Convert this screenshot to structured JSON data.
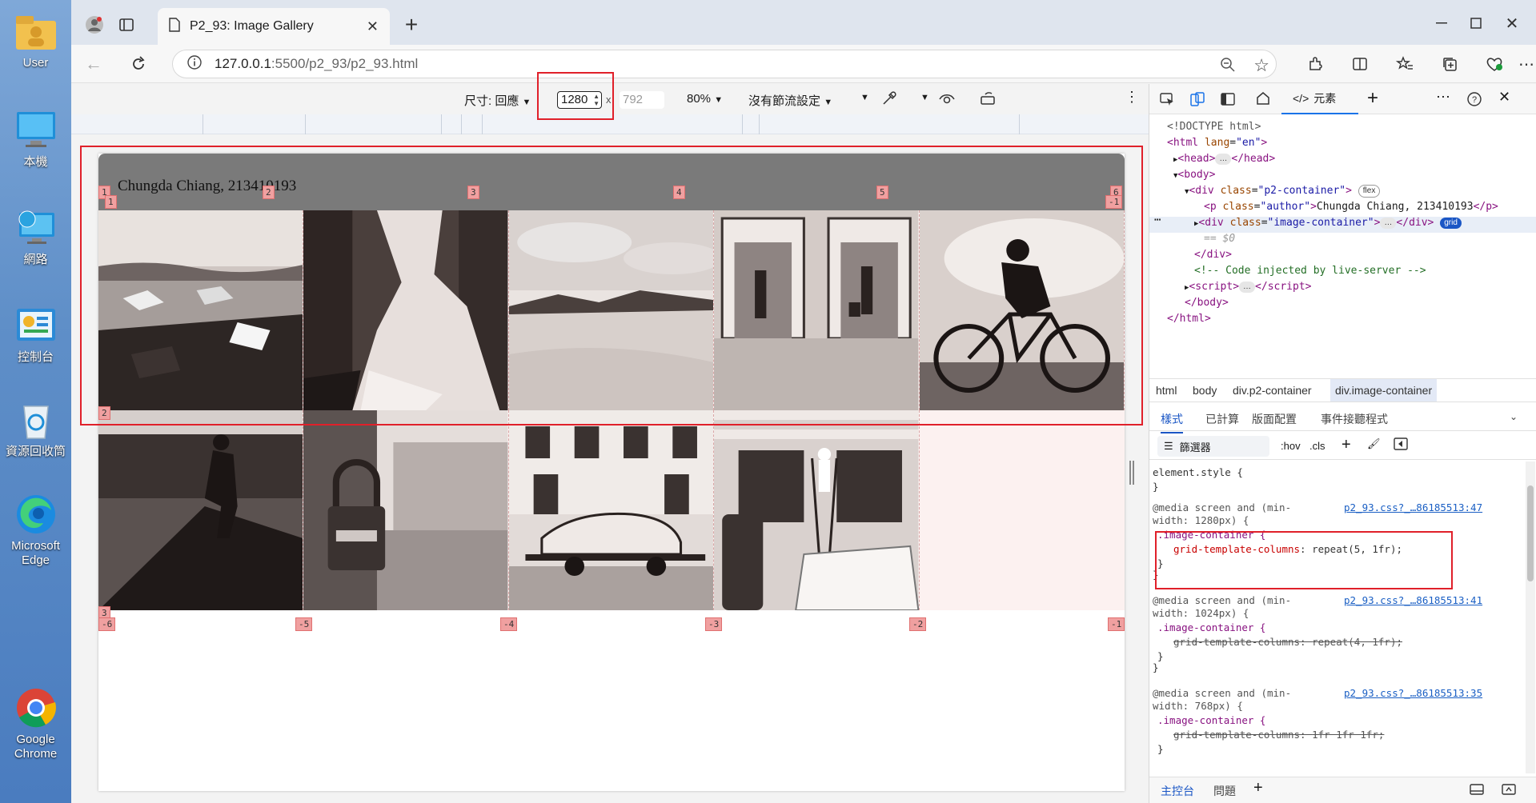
{
  "desktop": {
    "icons": [
      {
        "label": "User",
        "icon": "user-folder-icon"
      },
      {
        "label": "本機",
        "icon": "computer-icon"
      },
      {
        "label": "網路",
        "icon": "network-icon"
      },
      {
        "label": "控制台",
        "icon": "control-panel-icon"
      },
      {
        "label": "資源回收筒",
        "icon": "recycle-bin-icon"
      },
      {
        "label": "Microsoft Edge",
        "icon": "edge-icon"
      },
      {
        "label": "Google Chrome",
        "icon": "chrome-icon"
      }
    ]
  },
  "browser": {
    "tab_title": "P2_93: Image Gallery",
    "url_host": "127.0.0.1",
    "url_rest": ":5500/p2_93/p2_93.html"
  },
  "device_toolbar": {
    "dimensions_label": "尺寸: 回應",
    "width": "1280",
    "times": "x",
    "height": "792",
    "zoom": "80%",
    "throttle": "沒有節流設定"
  },
  "page": {
    "author": "Chungda Chiang, 213410193",
    "grid_badges": {
      "columns_top": [
        "1",
        "2",
        "3",
        "4",
        "5",
        "6"
      ],
      "columns_bottom": [
        "-6",
        "-5",
        "-4",
        "-3",
        "-2",
        "-1"
      ],
      "rows_left": [
        "1",
        "2",
        "3"
      ],
      "row_neg_top_right": "-1"
    },
    "images": [
      {
        "subject": "icebergs on shore"
      },
      {
        "subject": "forest waterfall"
      },
      {
        "subject": "desert dunes"
      },
      {
        "subject": "airport lifts"
      },
      {
        "subject": "cyclist silhouette"
      },
      {
        "subject": "walking man by building"
      },
      {
        "subject": "padlock on street"
      },
      {
        "subject": "car on trailer"
      },
      {
        "subject": "worker on ladder"
      }
    ]
  },
  "devtools": {
    "elements_tab": "元素",
    "dom": {
      "doctype": "<!DOCTYPE html>",
      "html_open_tag": "html",
      "html_lang_attr": "lang",
      "html_lang_val": "\"en\"",
      "head": "head",
      "body": "body",
      "div_class_val": "\"p2-container\"",
      "flex_pill": "flex",
      "p_class_val": "\"author\"",
      "p_text": "Chungda Chiang, 213410193",
      "imgc_class_val": "\"image-container\"",
      "grid_pill": "grid",
      "eq_s0": "== $0",
      "comment": "<!-- Code injected by live-server -->",
      "script": "script"
    },
    "breadcrumbs": [
      "html",
      "body",
      "div.p2-container",
      "div.image-container"
    ],
    "style_tabs": [
      "樣式",
      "已計算",
      "版面配置",
      "事件接聽程式"
    ],
    "filter_label": "篩選器",
    "hov": ":hov",
    "cls": ".cls",
    "styles": {
      "element_style": "element.style {",
      "close": "}",
      "rule1": {
        "media_a": "@media screen and (min-",
        "media_b": "width: 1280px) {",
        "source": "p2_93.css?_…86185513:47",
        "selector": ".image-container {",
        "prop": "grid-template-columns",
        "value": "repeat(5, 1fr);"
      },
      "rule2": {
        "media_a": "@media screen and (min-",
        "media_b": "width: 1024px) {",
        "source": "p2_93.css?_…86185513:41",
        "selector": ".image-container {",
        "prop": "grid-template-columns",
        "value": "repeat(4, 1fr);"
      },
      "rule3": {
        "media_a": "@media screen and (min-",
        "media_b": "width: 768px) {",
        "source": "p2_93.css?_…86185513:35",
        "selector": ".image-container {",
        "prop": "grid-template-columns",
        "value": "1fr 1fr 1fr;"
      }
    },
    "console_tabs": [
      "主控台",
      "問題"
    ]
  }
}
